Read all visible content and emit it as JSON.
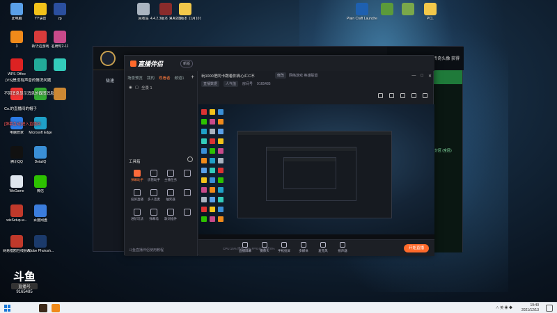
{
  "desktop": {
    "icons_left": [
      {
        "label": "此电脑",
        "color": "#5aa0e8"
      },
      {
        "label": "YY语音",
        "color": "#f2c21a"
      },
      {
        "label": "zp",
        "color": "#2b4f9e"
      },
      {
        "label": "3",
        "color": "#f08a1a"
      },
      {
        "label": "新华边游戏",
        "color": "#d83b3b"
      },
      {
        "label": "名牌时2-11",
        "color": "#c84a8a"
      },
      {
        "label": "WPS Office",
        "color": "#d22"
      },
      {
        "label": "",
        "color": "#2a9"
      },
      {
        "label": "",
        "color": "#3cb"
      },
      {
        "label": "",
        "color": "#e33"
      },
      {
        "label": "",
        "color": "#3a3"
      },
      {
        "label": "",
        "color": "#c83"
      },
      {
        "label": "电脑管家",
        "color": "#2c7be5"
      },
      {
        "label": "Microsoft Edge",
        "color": "#1fa0c8"
      },
      {
        "label": "腾讯QQ",
        "color": "#111"
      },
      {
        "label": "DetailQ",
        "color": "#3a8fd6"
      },
      {
        "label": "WeGame",
        "color": "#dfe6ee"
      },
      {
        "label": "微信",
        "color": "#2dc100"
      },
      {
        "label": "wixSetup-w...",
        "color": "#c0392b"
      },
      {
        "label": "百度网盘",
        "color": "#3b7ddd"
      },
      {
        "label": "网易猎鸥在线射发",
        "color": "#c0392b"
      },
      {
        "label": "Adobe Photosh...",
        "color": "#1b3a6b"
      }
    ],
    "icons_top": [
      {
        "label": "回收站",
        "color": "#aab4c0"
      },
      {
        "label": "4.4.2.3版本 11月10日...",
        "color": "#8a2b2b"
      },
      {
        "label": "4.4.2.3版本 11月10日...",
        "color": "#f3c84a"
      },
      {
        "label": "Plain Craft Launcher...",
        "color": "#1e60b0"
      },
      {
        "label": "",
        "color": "#5b9a3a"
      },
      {
        "label": "",
        "color": "#7aa84a"
      },
      {
        "label": "PCL",
        "color": "#f3c84a"
      }
    ],
    "overlay_texts": [
      "[VS]是没有声音的情况问题",
      "不回消息显示消息的截图消息",
      "Co.的直播间的帽子",
      "[弹幕互动]进入直播间"
    ]
  },
  "outer_app": {
    "left_label": "极速",
    "topbar_text": "开启传奇头像 获得",
    "right_chip": "分区 (全区)"
  },
  "assistant": {
    "app_name": "直播伴侣",
    "version": "新版",
    "tabs": [
      "场景预览",
      "我的",
      "观看者",
      "频道1"
    ],
    "active_tab": 2,
    "add": "+",
    "scene_label": "全景 1",
    "tools_title": "工具箱",
    "tools": [
      {
        "label": "弹幕助手",
        "hot": true
      },
      {
        "label": "房管助手",
        "hot": false
      },
      {
        "label": "主播任务",
        "hot": false
      },
      {
        "label": "",
        "hot": false
      },
      {
        "label": "投屏直播",
        "hot": false
      },
      {
        "label": "多人连麦",
        "hot": false
      },
      {
        "label": "抽奖器",
        "hot": false
      },
      {
        "label": "",
        "hot": false
      },
      {
        "label": "进阶玩法",
        "hot": false
      },
      {
        "label": "弹幕墙",
        "hot": false
      },
      {
        "label": "歌词插件",
        "hot": false
      },
      {
        "label": "",
        "hot": false
      }
    ],
    "notice": "斗鱼直播伴侣使用教程",
    "room_title": "玩1000把同卡跟着你真心汇C不",
    "edit_label": "修改",
    "category": "网络游戏 英雄联盟",
    "info_tags": [
      "直播数据",
      "人气值",
      "房间号",
      "9165485"
    ],
    "win_controls": [
      "—",
      "□",
      "✕"
    ],
    "bottom_sources": [
      "直播屏幕",
      "摄像头",
      "手机投屏",
      "多媒体",
      "麦克风",
      "扬声器"
    ],
    "start_live": "开始直播",
    "stats": "CPU:15% 内存:30% FPS:60 丢帧:0%"
  },
  "watermark": {
    "logo": "斗鱼",
    "sub": "直播号",
    "room_id": "9165485"
  },
  "taskbar": {
    "time": "19:40",
    "date": "2021/12/13",
    "tray": "∧ 英 ◉ ◆"
  }
}
